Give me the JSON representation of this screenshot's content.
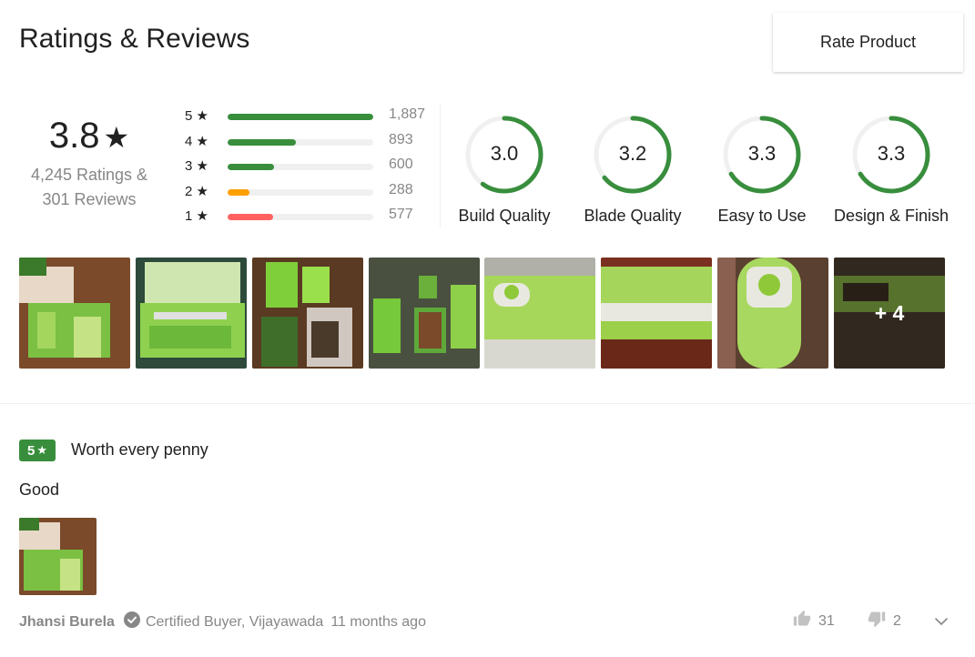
{
  "header": {
    "title": "Ratings & Reviews",
    "rate_button_label": "Rate Product"
  },
  "summary": {
    "overall_rating": "3.8",
    "star": "★",
    "ratings_count": "4,245 Ratings &",
    "reviews_count": "301 Reviews"
  },
  "distribution": [
    {
      "label": "5",
      "count": "1,887",
      "fraction": 1.0,
      "color": "#388e3c"
    },
    {
      "label": "4",
      "count": "893",
      "fraction": 0.47,
      "color": "#388e3c"
    },
    {
      "label": "3",
      "count": "600",
      "fraction": 0.32,
      "color": "#388e3c"
    },
    {
      "label": "2",
      "count": "288",
      "fraction": 0.15,
      "color": "#ff9f00"
    },
    {
      "label": "1",
      "count": "577",
      "fraction": 0.31,
      "color": "#ff6161"
    }
  ],
  "aspects": [
    {
      "value": "3.0",
      "label": "Build Quality",
      "fraction": 0.6
    },
    {
      "value": "3.2",
      "label": "Blade Quality",
      "fraction": 0.64
    },
    {
      "value": "3.3",
      "label": "Easy to Use",
      "fraction": 0.66
    },
    {
      "value": "3.3",
      "label": "Design & Finish",
      "fraction": 0.66
    }
  ],
  "photos": {
    "more_label": "+ 4"
  },
  "review": {
    "rating": "5",
    "star": "★",
    "title": "Worth every penny",
    "body": "Good",
    "reviewer": "Jhansi Burela",
    "certified": "Certified Buyer, Vijayawada",
    "time": "11 months ago",
    "likes": "31",
    "dislikes": "2"
  },
  "colors": {
    "accent_green": "#388e3c",
    "muted_text": "#878787",
    "track": "#f0f0f0"
  },
  "icons": [
    "star-icon",
    "thumbs-up-icon",
    "thumbs-down-icon",
    "certified-check-icon",
    "chevron-down-icon"
  ]
}
